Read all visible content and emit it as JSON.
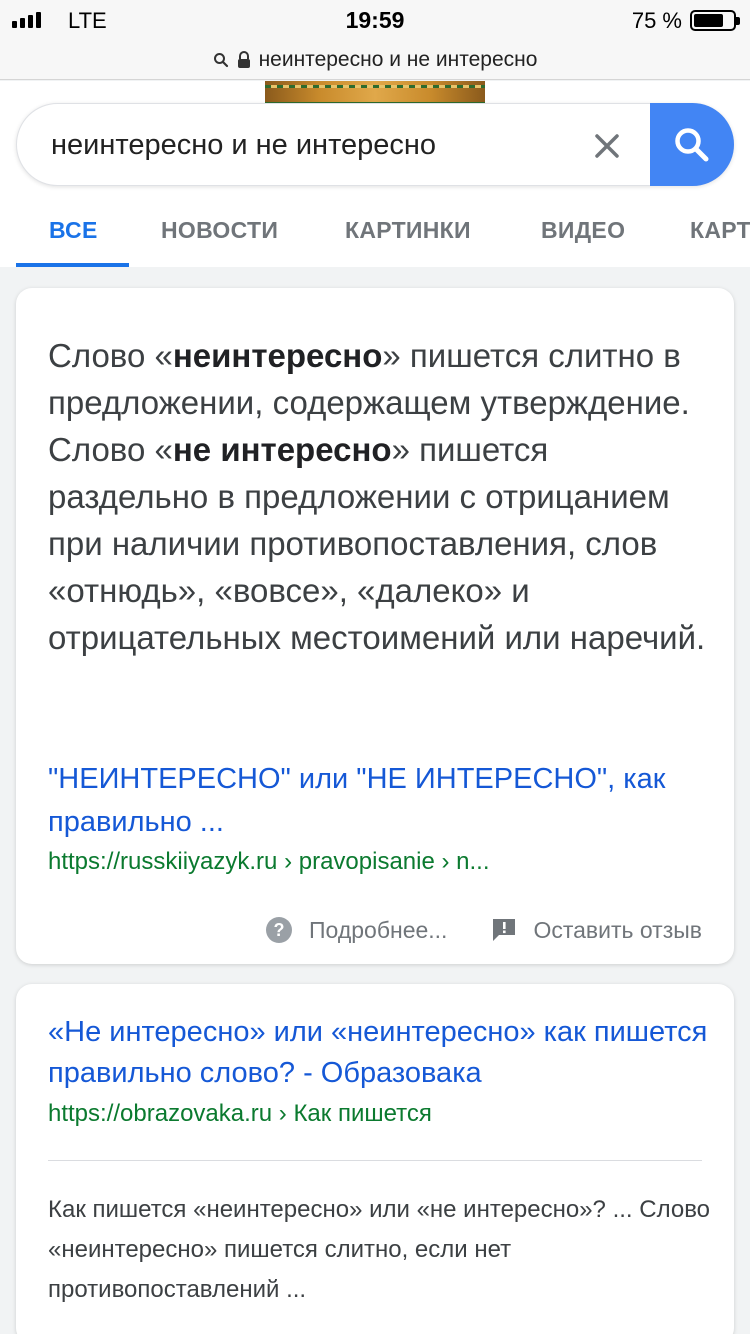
{
  "status": {
    "carrier": "LTE",
    "time": "19:59",
    "battery_pct": "75 %",
    "battery_level": 0.75
  },
  "url": {
    "text": "неинтересно и не интересно",
    "icons": [
      "search-icon",
      "lock-icon"
    ]
  },
  "search": {
    "query": "неинтересно и не интересно",
    "colors": {
      "button": "#4285f4"
    }
  },
  "tabs": [
    {
      "label": "ВСЕ",
      "active": true
    },
    {
      "label": "НОВОСТИ"
    },
    {
      "label": "КАРТИНКИ"
    },
    {
      "label": "ВИДЕО"
    },
    {
      "label": "КАРТ"
    }
  ],
  "featured": {
    "answer": [
      {
        "t": "Слово «"
      },
      {
        "t": "неинтересно",
        "b": true
      },
      {
        "t": "» пишется слитно в предложении, содержащем утверждение. Слово «"
      },
      {
        "t": "не интересно",
        "b": true
      },
      {
        "t": "» пишется раздельно в предложении с отрицанием при наличии противопоставления, слов «отнюдь», «вовсе», «далеко» и отрицательных местоимений или наречий."
      }
    ],
    "source_title": "\"НЕИНТЕРЕСНО\" или \"НЕ ИНТЕРЕСНО\", как правильно ...",
    "source_url": "https://russkiiyazyk.ru › pravopisanie › n...",
    "more_label": "Подробнее...",
    "feedback_label": "Оставить отзыв"
  },
  "result": {
    "title": "«Не интересно» или «неинтересно» как пишется правильно слово? - Образовака",
    "url": "https://obrazovaka.ru › Как пишется",
    "snippet": "Как пишется «неинтересно» или «не интересно»? ... Слово «неинтересно» пишется слитно, если нет противопоставлений ..."
  }
}
